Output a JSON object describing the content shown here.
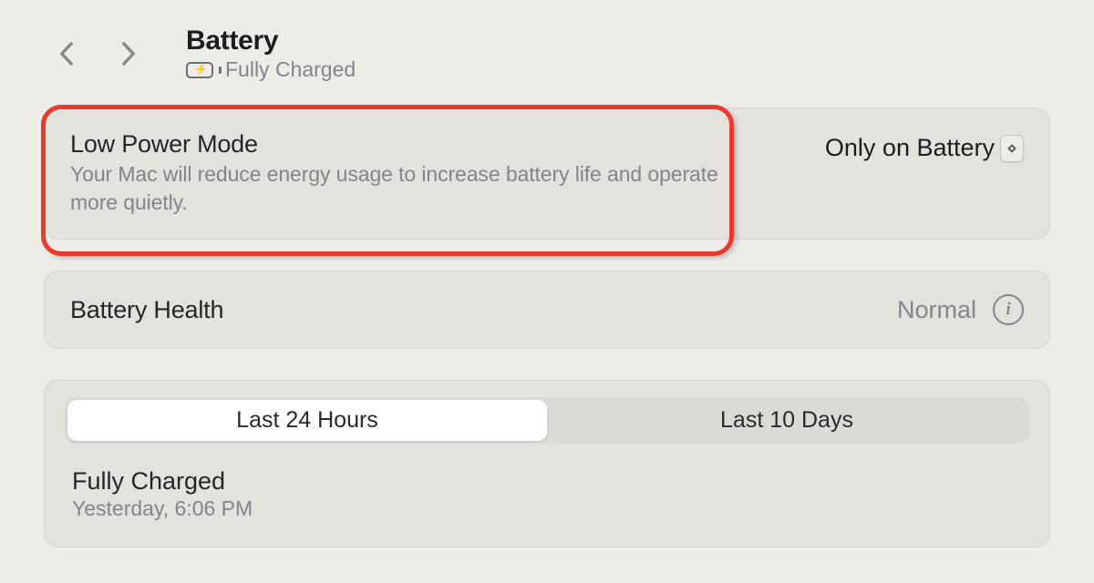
{
  "header": {
    "title": "Battery",
    "status": "Fully Charged"
  },
  "lowPowerMode": {
    "title": "Low Power Mode",
    "description": "Your Mac will reduce energy usage to increase battery life and operate more quietly.",
    "selected": "Only on Battery"
  },
  "batteryHealth": {
    "label": "Battery Health",
    "value": "Normal"
  },
  "history": {
    "tabs": [
      "Last 24 Hours",
      "Last 10 Days"
    ],
    "activeTab": 0,
    "status": "Fully Charged",
    "timestamp": "Yesterday, 6:06 PM"
  }
}
